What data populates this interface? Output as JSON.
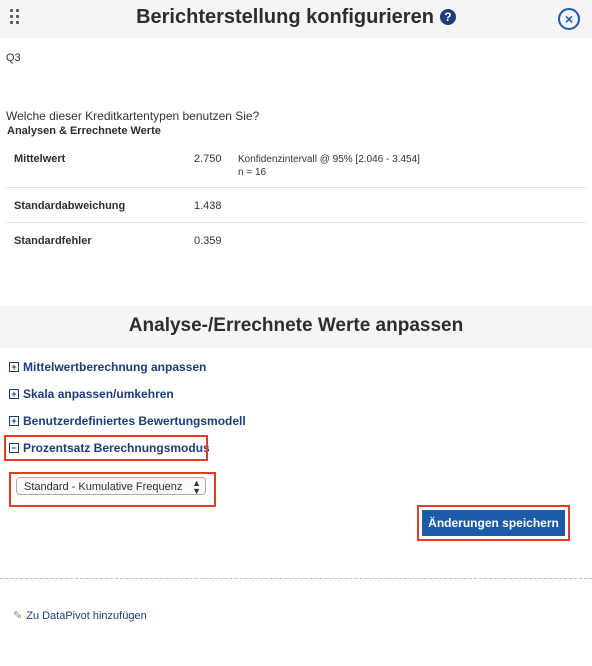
{
  "dialog": {
    "title": "Berichterstellung konfigurieren",
    "help_glyph": "?",
    "close_glyph": "×"
  },
  "question": {
    "label": "Q3",
    "text": "Welche dieser Kreditkartentypen benutzen Sie?"
  },
  "analysis": {
    "title": "Analysen & Errechnete Werte",
    "rows": [
      {
        "name": "Mittelwert",
        "value": "2.750",
        "extra1": "Konfidenzintervall @ 95% [2.046 - 3.454]",
        "extra2": "n = 16"
      },
      {
        "name": "Standardabweichung",
        "value": "1.438"
      },
      {
        "name": "Standardfehler",
        "value": "0.359"
      }
    ]
  },
  "adjust": {
    "title": "Analyse-/Errechnete Werte anpassen",
    "options": [
      {
        "label": "Mittelwertberechnung anpassen",
        "symbol": "+"
      },
      {
        "label": "Skala anpassen/umkehren",
        "symbol": "+"
      },
      {
        "label": "Benutzerdefiniertes Bewertungsmodell",
        "symbol": "+"
      },
      {
        "label": "Prozentsatz Berechnungsmodus",
        "symbol": "−"
      }
    ],
    "mode_select": {
      "selected": "Standard - Kumulative Frequenz"
    },
    "save_label": "Änderungen speichern"
  },
  "datapivot": {
    "link": "Zu DataPivot hinzufügen"
  },
  "colors": {
    "accent": "#1c5ba8",
    "link": "#1c3c7a",
    "highlight": "#e23b26",
    "band": "#f5f5f5"
  },
  "icons": {
    "drag": "drag-handle-icon",
    "help": "help-icon",
    "close": "close-icon",
    "expand": "plus-square-icon",
    "collapse": "minus-square-icon",
    "edit": "pencil-icon"
  }
}
